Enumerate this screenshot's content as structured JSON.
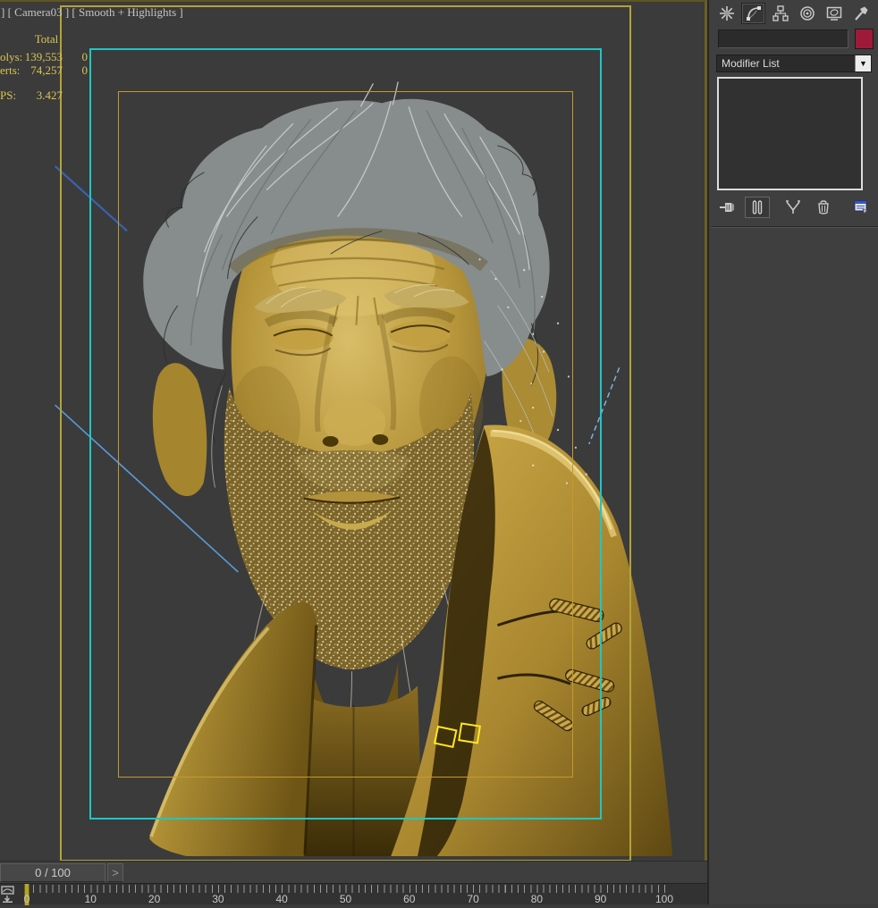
{
  "viewport": {
    "label": "] [ Camera03 ] [ Smooth + Highlights ]",
    "stats": {
      "col_header": "Total",
      "rows": [
        {
          "label": "olys:",
          "total": "139,553",
          "selected": "0"
        },
        {
          "label": "erts:",
          "total": "74,257",
          "selected": "0"
        }
      ],
      "fps_label": "PS:",
      "fps_value": "3.427"
    },
    "safe_frame_colors": {
      "live_area": "#b2a338",
      "action_safe": "#1fc6c6",
      "title_safe": "#c49a2b"
    }
  },
  "command_panel": {
    "tabs": [
      {
        "name": "create",
        "icon": "starburst-icon",
        "active": false
      },
      {
        "name": "modify",
        "icon": "bezier-arc-icon",
        "active": true
      },
      {
        "name": "hierarchy",
        "icon": "org-chart-icon",
        "active": false
      },
      {
        "name": "motion",
        "icon": "wheel-icon",
        "active": false
      },
      {
        "name": "display",
        "icon": "monitor-icon",
        "active": false
      },
      {
        "name": "utilities",
        "icon": "hammer-icon",
        "active": false
      }
    ],
    "object_name_value": "",
    "object_color": "#9e1a39",
    "modifier_list_label": "Modifier List",
    "modifier_stack_items": [],
    "stack_buttons": [
      "pin-stack",
      "show-end-result",
      "make-unique",
      "remove-modifier",
      "configure-modifier-sets"
    ]
  },
  "timeline": {
    "slider_value": "0 / 100",
    "next_frame_label": ">",
    "current_frame": 0,
    "ruler_labels": [
      "0",
      "10",
      "20",
      "30",
      "40",
      "50",
      "60",
      "70",
      "80",
      "90",
      "100"
    ]
  }
}
